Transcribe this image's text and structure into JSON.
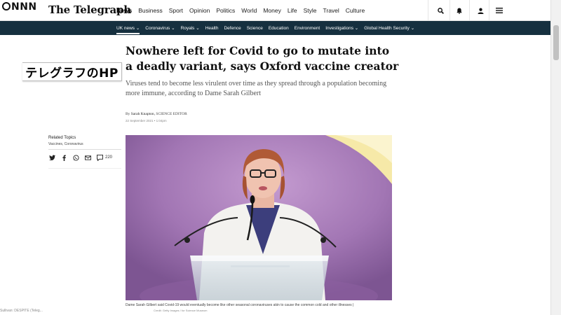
{
  "overlay": {
    "channel_logo": "NNN",
    "label": "テレグラフのHP",
    "ticker": "Sullivan: DESPITE (Teleg..."
  },
  "header": {
    "masthead": "The Telegraph",
    "nav": [
      "News",
      "Business",
      "Sport",
      "Opinion",
      "Politics",
      "World",
      "Money",
      "Life",
      "Style",
      "Travel",
      "Culture"
    ],
    "icons": [
      "search-icon",
      "notification-icon",
      "account-icon",
      "menu-icon"
    ]
  },
  "subnav": {
    "items": [
      "UK news ⌄",
      "Coronavirus ⌄",
      "Royals ⌄",
      "Health",
      "Defence",
      "Science",
      "Education",
      "Environment",
      "Investigations ⌄",
      "Global Health Security ⌄"
    ]
  },
  "article": {
    "headline": "Nowhere left for Covid to go to mutate into a deadly variant, says Oxford vaccine creator",
    "standfirst": "Viruses tend to become less virulent over time as they spread through a population becoming more immune, according to Dame Sarah Gilbert",
    "byline_prefix": "By",
    "byline_author": "Sarah Knapton,",
    "byline_role": "SCIENCE EDITOR",
    "dateline": "22 September 2021 • 1:04pm",
    "caption": "Dame Sarah Gilbert said Covid-19 would eventually become like other seasonal coronaviruses akin to cause the common cold and other illnesses |",
    "credit": "Credit: Getty Images / for Science Museum"
  },
  "sidebar": {
    "related_title": "Related Topics",
    "related_tags": "Vaccines, Coronavirus",
    "comment_count": "220"
  },
  "colors": {
    "subnav_bg": "#16303f",
    "photo_bg": "#9b6aa9"
  }
}
